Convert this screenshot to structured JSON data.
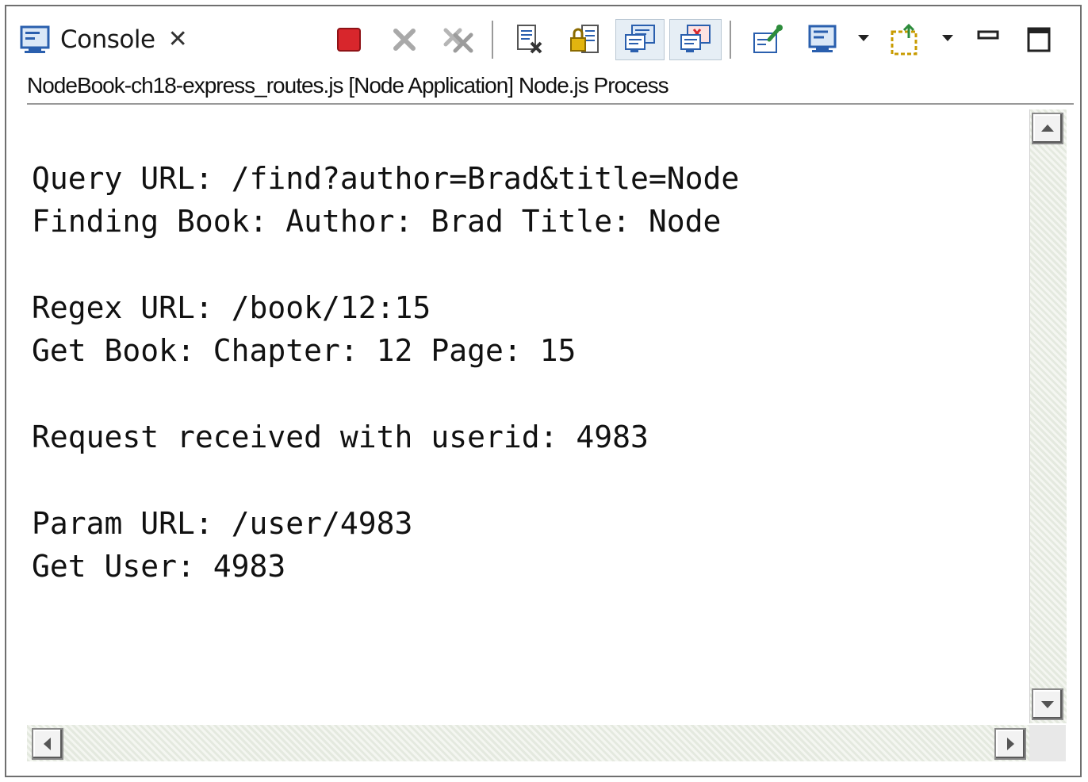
{
  "tab": {
    "label": "Console",
    "icon": "console-icon"
  },
  "process_line": "NodeBook-ch18-express_routes.js [Node Application] Node.js Process",
  "toolbar": {
    "icons": [
      "terminate-icon",
      "remove-launch-icon",
      "remove-all-terminated-icon",
      "clear-console-icon",
      "scroll-lock-icon",
      "show-on-stdout-icon",
      "show-on-stderr-icon",
      "pin-console-icon",
      "display-console-icon",
      "open-console-icon",
      "minimize-icon",
      "maximize-icon"
    ]
  },
  "output": {
    "query_url": "Query URL: /find?author=Brad&title=Node",
    "finding_book": "Finding Book: Author: Brad Title: Node",
    "regex_url": "Regex URL: /book/12:15",
    "get_book": "Get Book: Chapter: 12 Page: 15",
    "request_received": "Request received with userid: 4983",
    "param_url": "Param URL: /user/4983",
    "get_user": "Get User: 4983"
  },
  "colors": {
    "terminate": "#d8262c",
    "icon_blue": "#2a5fae",
    "accent_green": "#2d8c3c",
    "border": "#6f6f6f"
  }
}
